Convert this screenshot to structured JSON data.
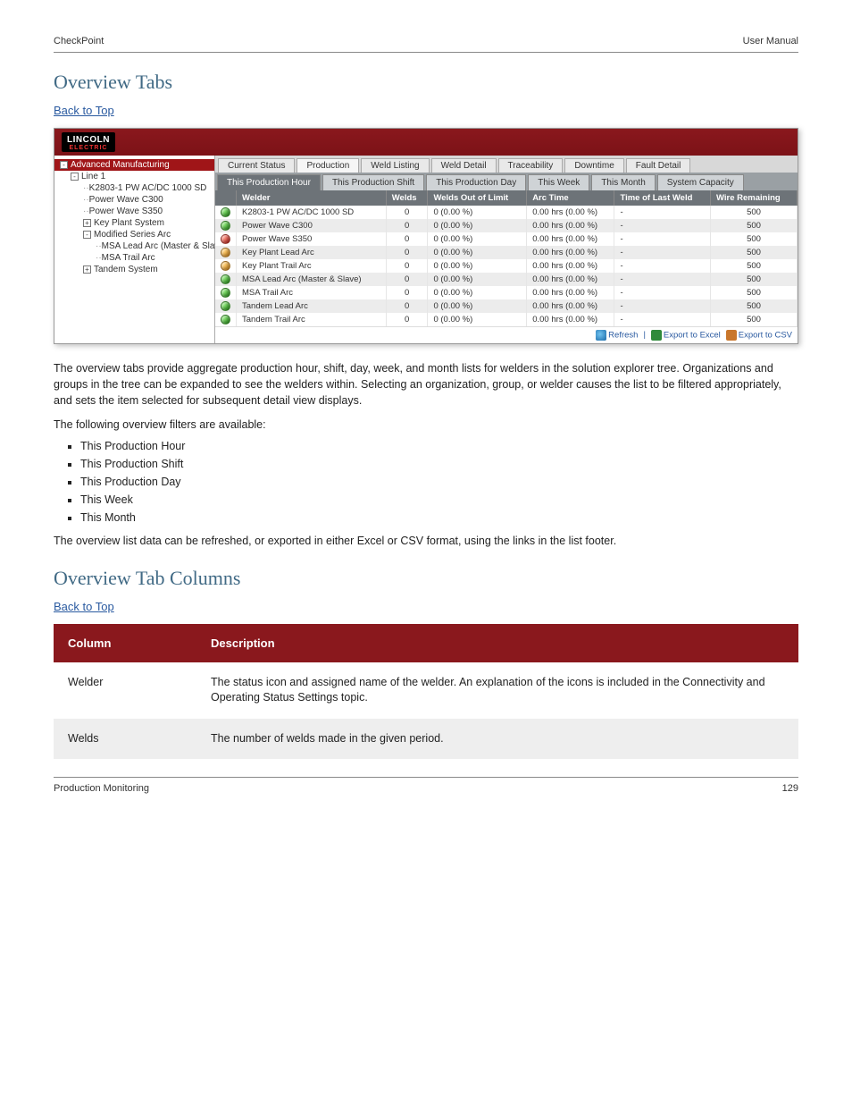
{
  "doc": {
    "header_left": "CheckPoint",
    "header_right": "User Manual",
    "footer_left": "Production Monitoring",
    "footer_right": "129"
  },
  "sections": {
    "overview_title": "Overview Tabs",
    "link_back_to_top": "Back to Top",
    "overview_body": "The overview tabs provide aggregate production hour, shift, day, week, and month lists for welders in the solution explorer tree. Organizations and groups in the tree can be expanded to see the welders within. Selecting an organization, group, or welder causes the list to be filtered appropriately, and sets the item selected for subsequent detail view displays.",
    "overview_filters_intro": "The following overview filters are available:",
    "filters": [
      "This Production Hour",
      "This Production Shift",
      "This Production Day",
      "This Week",
      "This Month"
    ],
    "overview_export": "The overview list data can be refreshed, or exported in either Excel or CSV format, using the links in the list footer.",
    "cols_title": "Overview Tab Columns",
    "cols_header_col": "Column",
    "cols_header_desc": "Description",
    "cols": [
      {
        "col": "Welder",
        "desc": "The status icon and assigned name of the welder. An explanation of the icons is included in the Connectivity and Operating Status Settings topic."
      },
      {
        "col": "Welds",
        "desc": "The number of welds made in the given period."
      }
    ]
  },
  "shot": {
    "logo_top": "LINCOLN",
    "logo_sub": "ELECTRIC",
    "tree": [
      {
        "depth": 0,
        "expander": "-",
        "label": "Advanced Manufacturing",
        "selected": true
      },
      {
        "depth": 1,
        "expander": "-",
        "label": "Line 1"
      },
      {
        "depth": 2,
        "label": "K2803-1 PW AC/DC 1000 SD"
      },
      {
        "depth": 2,
        "label": "Power Wave C300"
      },
      {
        "depth": 2,
        "label": "Power Wave S350"
      },
      {
        "depth": 2,
        "expander": "+",
        "label": "Key Plant System"
      },
      {
        "depth": 2,
        "expander": "-",
        "label": "Modified Series Arc"
      },
      {
        "depth": 3,
        "label": "MSA Lead Arc (Master & Slave)"
      },
      {
        "depth": 3,
        "label": "MSA Trail Arc"
      },
      {
        "depth": 2,
        "expander": "+",
        "label": "Tandem System"
      }
    ],
    "tabs": [
      "Current Status",
      "Production",
      "Weld Listing",
      "Weld Detail",
      "Traceability",
      "Downtime",
      "Fault Detail"
    ],
    "active_tab": 1,
    "subtabs": [
      "This Production Hour",
      "This Production Shift",
      "This Production Day",
      "This Week",
      "This Month",
      "System Capacity"
    ],
    "active_subtab": 0,
    "columns": [
      "Welder",
      "Welds",
      "Welds Out of Limit",
      "Arc Time",
      "Time of Last Weld",
      "Wire Remaining"
    ],
    "rows": [
      {
        "status": "green",
        "welder": "K2803-1 PW AC/DC 1000 SD",
        "welds": "0",
        "out": "0 (0.00 %)",
        "arc": "0.00 hrs (0.00 %)",
        "last": "-",
        "wire": "500"
      },
      {
        "status": "green",
        "welder": "Power Wave C300",
        "welds": "0",
        "out": "0 (0.00 %)",
        "arc": "0.00 hrs (0.00 %)",
        "last": "-",
        "wire": "500"
      },
      {
        "status": "red",
        "welder": "Power Wave S350",
        "welds": "0",
        "out": "0 (0.00 %)",
        "arc": "0.00 hrs (0.00 %)",
        "last": "-",
        "wire": "500"
      },
      {
        "status": "orange",
        "welder": "Key Plant Lead Arc",
        "welds": "0",
        "out": "0 (0.00 %)",
        "arc": "0.00 hrs (0.00 %)",
        "last": "-",
        "wire": "500"
      },
      {
        "status": "orange",
        "welder": "Key Plant Trail Arc",
        "welds": "0",
        "out": "0 (0.00 %)",
        "arc": "0.00 hrs (0.00 %)",
        "last": "-",
        "wire": "500"
      },
      {
        "status": "green",
        "welder": "MSA Lead Arc (Master & Slave)",
        "welds": "0",
        "out": "0 (0.00 %)",
        "arc": "0.00 hrs (0.00 %)",
        "last": "-",
        "wire": "500"
      },
      {
        "status": "green",
        "welder": "MSA Trail Arc",
        "welds": "0",
        "out": "0 (0.00 %)",
        "arc": "0.00 hrs (0.00 %)",
        "last": "-",
        "wire": "500"
      },
      {
        "status": "green",
        "welder": "Tandem Lead Arc",
        "welds": "0",
        "out": "0 (0.00 %)",
        "arc": "0.00 hrs (0.00 %)",
        "last": "-",
        "wire": "500"
      },
      {
        "status": "green",
        "welder": "Tandem Trail Arc",
        "welds": "0",
        "out": "0 (0.00 %)",
        "arc": "0.00 hrs (0.00 %)",
        "last": "-",
        "wire": "500"
      }
    ],
    "footer_links": {
      "refresh": "Refresh",
      "excel": "Export to Excel",
      "csv": "Export to CSV"
    }
  }
}
